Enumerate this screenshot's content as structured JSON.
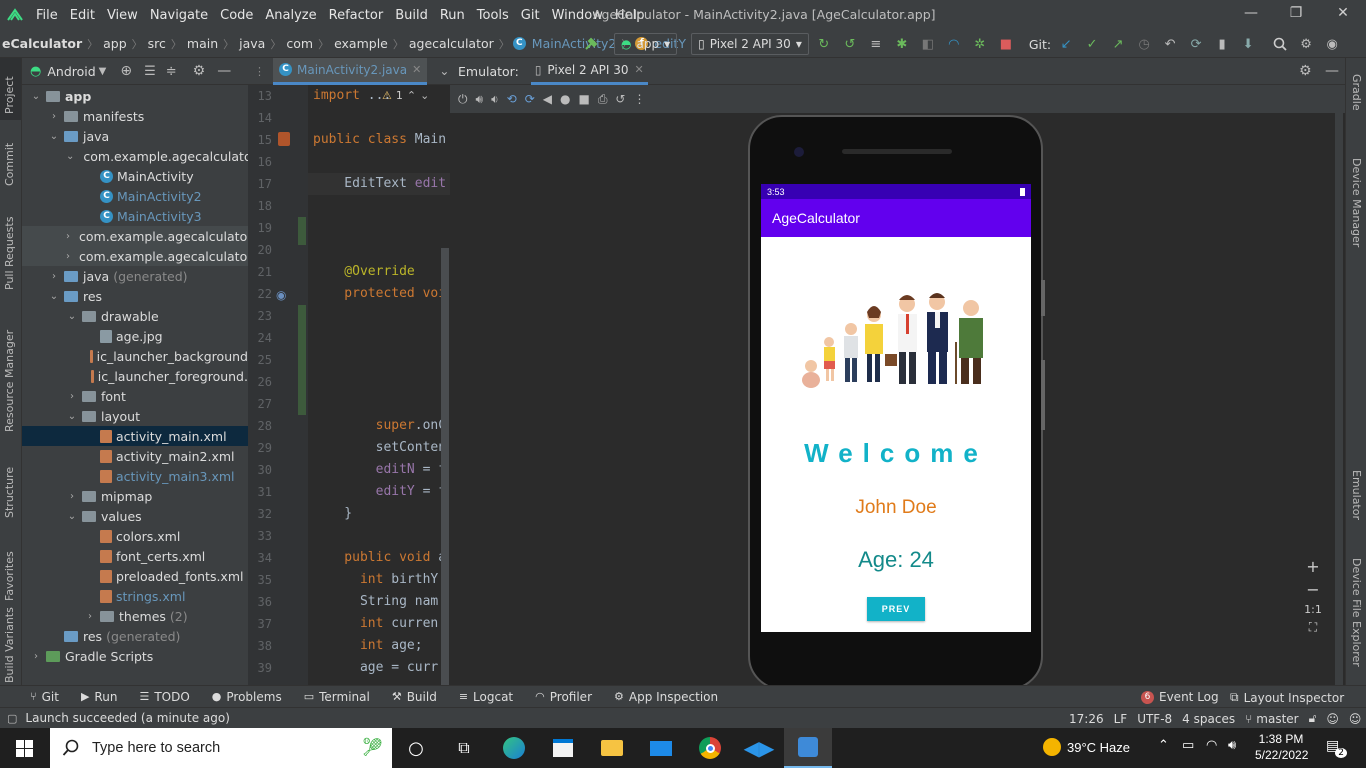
{
  "menu": {
    "items": [
      "File",
      "Edit",
      "View",
      "Navigate",
      "Code",
      "Analyze",
      "Refactor",
      "Build",
      "Run",
      "Tools",
      "Git",
      "Window",
      "Help"
    ],
    "title": "AgeCalculator - MainActivity2.java [AgeCalculator.app]"
  },
  "nav": {
    "crumbs": [
      "eCalculator",
      "app",
      "src",
      "main",
      "java",
      "com",
      "example",
      "agecalculator",
      "MainActivity2",
      "editY"
    ],
    "run_config": "app",
    "device": "Pixel 2 API 30",
    "git_label": "Git:"
  },
  "left_strip": [
    "Project",
    "Commit",
    "Pull Requests",
    "Resource Manager",
    "Structure",
    "Favorites",
    "Build Variants"
  ],
  "project": {
    "view": "Android",
    "tree": [
      {
        "d": 0,
        "arrow": "v",
        "icon": "folder",
        "label": "app",
        "bold": true
      },
      {
        "d": 1,
        "arrow": ">",
        "icon": "folder",
        "label": "manifests"
      },
      {
        "d": 1,
        "arrow": "v",
        "icon": "folder",
        "label": "java"
      },
      {
        "d": 2,
        "arrow": "v",
        "icon": "pkg",
        "label": "com.example.agecalculator"
      },
      {
        "d": 3,
        "arrow": "",
        "icon": "class",
        "label": "MainActivity"
      },
      {
        "d": 3,
        "arrow": "",
        "icon": "class",
        "label": "MainActivity2",
        "blue": true
      },
      {
        "d": 3,
        "arrow": "",
        "icon": "class",
        "label": "MainActivity3",
        "blue": true
      },
      {
        "d": 2,
        "arrow": ">",
        "icon": "pkg",
        "label": "com.example.agecalculator",
        "hl": true
      },
      {
        "d": 2,
        "arrow": ">",
        "icon": "pkg",
        "label": "com.example.agecalculator",
        "hl": true
      },
      {
        "d": 1,
        "arrow": ">",
        "icon": "folder",
        "label": "java",
        "suffix": "(generated)"
      },
      {
        "d": 1,
        "arrow": "v",
        "icon": "folder",
        "label": "res"
      },
      {
        "d": 2,
        "arrow": "v",
        "icon": "folder",
        "label": "drawable"
      },
      {
        "d": 3,
        "arrow": "",
        "icon": "img",
        "label": "age.jpg"
      },
      {
        "d": 3,
        "arrow": "",
        "icon": "xml",
        "label": "ic_launcher_background"
      },
      {
        "d": 3,
        "arrow": "",
        "icon": "xml",
        "label": "ic_launcher_foreground."
      },
      {
        "d": 2,
        "arrow": ">",
        "icon": "folder",
        "label": "font"
      },
      {
        "d": 2,
        "arrow": "v",
        "icon": "folder",
        "label": "layout"
      },
      {
        "d": 3,
        "arrow": "",
        "icon": "xml",
        "label": "activity_main.xml",
        "sel": true
      },
      {
        "d": 3,
        "arrow": "",
        "icon": "xml",
        "label": "activity_main2.xml"
      },
      {
        "d": 3,
        "arrow": "",
        "icon": "xml",
        "label": "activity_main3.xml",
        "blue": true
      },
      {
        "d": 2,
        "arrow": ">",
        "icon": "folder",
        "label": "mipmap"
      },
      {
        "d": 2,
        "arrow": "v",
        "icon": "folder",
        "label": "values"
      },
      {
        "d": 3,
        "arrow": "",
        "icon": "xml",
        "label": "colors.xml"
      },
      {
        "d": 3,
        "arrow": "",
        "icon": "xml",
        "label": "font_certs.xml"
      },
      {
        "d": 3,
        "arrow": "",
        "icon": "xml",
        "label": "preloaded_fonts.xml"
      },
      {
        "d": 3,
        "arrow": "",
        "icon": "xml",
        "label": "strings.xml",
        "blue": true
      },
      {
        "d": 3,
        "arrow": ">",
        "icon": "folder",
        "label": "themes",
        "suffix": "(2)"
      },
      {
        "d": 1,
        "arrow": "",
        "icon": "folder",
        "label": "res",
        "suffix": "(generated)"
      },
      {
        "d": 0,
        "arrow": ">",
        "icon": "gradle",
        "label": "Gradle Scripts"
      }
    ]
  },
  "editor": {
    "tab": "MainActivity2.java",
    "warn": "1",
    "lines": [
      {
        "n": "13",
        "t": [
          [
            "kw",
            "import "
          ],
          [
            "",
            "..."
          ]
        ]
      },
      {
        "n": "14",
        "t": []
      },
      {
        "n": "15",
        "t": [
          [
            "kw",
            "public class "
          ],
          [
            "",
            "Main"
          ]
        ]
      },
      {
        "n": "16",
        "t": []
      },
      {
        "n": "17",
        "t": [
          [
            "",
            "    EditText "
          ],
          [
            "fn",
            "edit"
          ]
        ]
      },
      {
        "n": "18",
        "t": []
      },
      {
        "n": "19",
        "t": []
      },
      {
        "n": "20",
        "t": []
      },
      {
        "n": "21",
        "t": [
          [
            "an",
            "    @Override"
          ]
        ]
      },
      {
        "n": "22",
        "t": [
          [
            "kw",
            "    protected voi"
          ]
        ]
      },
      {
        "n": "23",
        "t": []
      },
      {
        "n": "24",
        "t": []
      },
      {
        "n": "25",
        "t": []
      },
      {
        "n": "26",
        "t": []
      },
      {
        "n": "27",
        "t": []
      },
      {
        "n": "28",
        "t": [
          [
            "kw",
            "        super"
          ],
          [
            "",
            "."
          ],
          [
            "",
            "onC"
          ]
        ]
      },
      {
        "n": "29",
        "t": [
          [
            "",
            "        setConten"
          ]
        ]
      },
      {
        "n": "30",
        "t": [
          [
            "fn",
            "        editN"
          ],
          [
            "",
            " = f"
          ]
        ]
      },
      {
        "n": "31",
        "t": [
          [
            "fn",
            "        editY"
          ],
          [
            "",
            " = f"
          ]
        ]
      },
      {
        "n": "32",
        "t": [
          [
            "",
            "    }"
          ]
        ]
      },
      {
        "n": "33",
        "t": []
      },
      {
        "n": "34",
        "t": [
          [
            "kw",
            "    public void "
          ],
          [
            "",
            "a"
          ]
        ]
      },
      {
        "n": "35",
        "t": [
          [
            "kw",
            "      int "
          ],
          [
            "",
            "birthY"
          ]
        ]
      },
      {
        "n": "36",
        "t": [
          [
            "",
            "      String nam"
          ]
        ]
      },
      {
        "n": "37",
        "t": [
          [
            "kw",
            "      int "
          ],
          [
            "",
            "curren"
          ]
        ]
      },
      {
        "n": "38",
        "t": [
          [
            "kw",
            "      int "
          ],
          [
            "",
            "age;"
          ]
        ]
      },
      {
        "n": "39",
        "t": [
          [
            "",
            "      age = curr"
          ]
        ]
      }
    ]
  },
  "emulator": {
    "label": "Emulator:",
    "tab": "Pixel 2 API 30"
  },
  "app": {
    "time": "3:53",
    "bar_title": "AgeCalculator",
    "welcome": "Welcome",
    "name": "John Doe",
    "age": "Age: 24",
    "button": "PREV",
    "accent": "#6200ee"
  },
  "right_strip": [
    "Gradle",
    "Device Manager",
    "Emulator",
    "Device File Explorer"
  ],
  "zoom": {
    "ratio": "1:1"
  },
  "toolwindows": {
    "left": [
      "Git",
      "Run",
      "TODO",
      "Problems",
      "Terminal",
      "Build",
      "Logcat",
      "Profiler",
      "App Inspection"
    ],
    "event_count": "6",
    "event": "Event Log",
    "inspector": "Layout Inspector"
  },
  "status": {
    "msg": "Launch succeeded (a minute ago)",
    "pos": "17:26",
    "lf": "LF",
    "enc": "UTF-8",
    "indent": "4 spaces",
    "branch": "master"
  },
  "taskbar": {
    "search": "Type here to search",
    "weather": "39°C  Haze",
    "time": "1:38 PM",
    "date": "5/22/2022",
    "notif": "2"
  }
}
